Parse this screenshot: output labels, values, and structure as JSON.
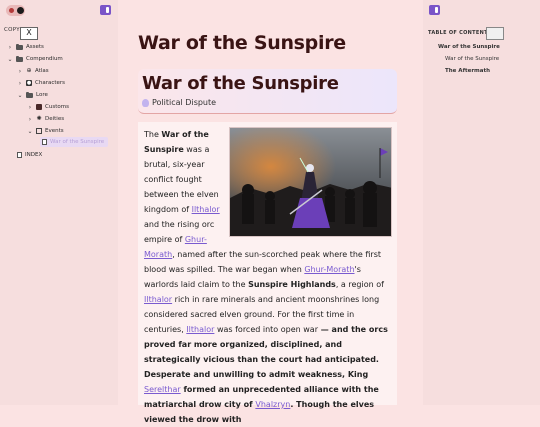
{
  "sidebar": {
    "copy_label": "COPY",
    "copy_button": "X",
    "tree": [
      {
        "label": "Assets",
        "icon": "folder-icon",
        "chevron": "›"
      },
      {
        "label": "Compendium",
        "icon": "folder-icon",
        "chevron": "⌄"
      },
      {
        "label": "Atlas",
        "icon": "globe-icon",
        "chevron": "›"
      },
      {
        "label": "Characters",
        "icon": "person-icon",
        "chevron": "›"
      },
      {
        "label": "Lore",
        "icon": "folder-icon",
        "chevron": "⌄"
      },
      {
        "label": "Customs",
        "icon": "book-icon",
        "chevron": "›"
      },
      {
        "label": "Deities",
        "icon": "sun-icon",
        "chevron": "›"
      },
      {
        "label": "Events",
        "icon": "calendar-icon",
        "chevron": "⌄"
      },
      {
        "label": "War of the Sunspire",
        "icon": "document-icon",
        "chevron": ""
      },
      {
        "label": "INDEX",
        "icon": "document-icon",
        "chevron": ""
      }
    ]
  },
  "main": {
    "page_title": "War of the Sunspire",
    "card_title": "War of the Sunspire",
    "card_subtitle": "Political Dispute",
    "body": {
      "p1_the": "The ",
      "p1_bold1": "War of the Sunspire",
      "p1_t1": " was a brutal, six-year conflict fought between the elven kingdom of ",
      "link_ilthalor": "Ilthalor",
      "p1_t2": " and the rising orc empire of ",
      "link_ghur": "Ghur-Morath",
      "p1_t3": ", named after the sun-scorched peak where the first blood was spilled. The war began when ",
      "p1_t4": "'s warlords laid claim to the ",
      "p1_bold2": "Sunspire Highlands",
      "p1_t5": ", a region of ",
      "p1_t6": " rich in rare minerals and ancient moonshrines long considered sacred elven ground. For the first time in centuries, ",
      "p1_t7": " was forced into open war",
      "p1_bold3": " — and the orcs proved far more organized, disciplined, and strategically vicious than the court had anticipated.",
      "p2_bold1": "Desperate and unwilling to admit weakness, King ",
      "link_king": "Serelthar",
      "p2_bold2": " formed an unprecedented alliance with the matriarchal drow city of ",
      "link_city": "Vhalzryn",
      "p2_bold3": ". Though the elves viewed the drow with"
    }
  },
  "toc": {
    "title": "TABLE OF CONTENTS",
    "items": [
      "War of the Sunspire",
      "War of the Sunspire",
      "The Aftermath"
    ]
  },
  "colors": {
    "accent": "#7a54c8",
    "background": "#fbe3e3",
    "link": "#7a5bd0"
  }
}
